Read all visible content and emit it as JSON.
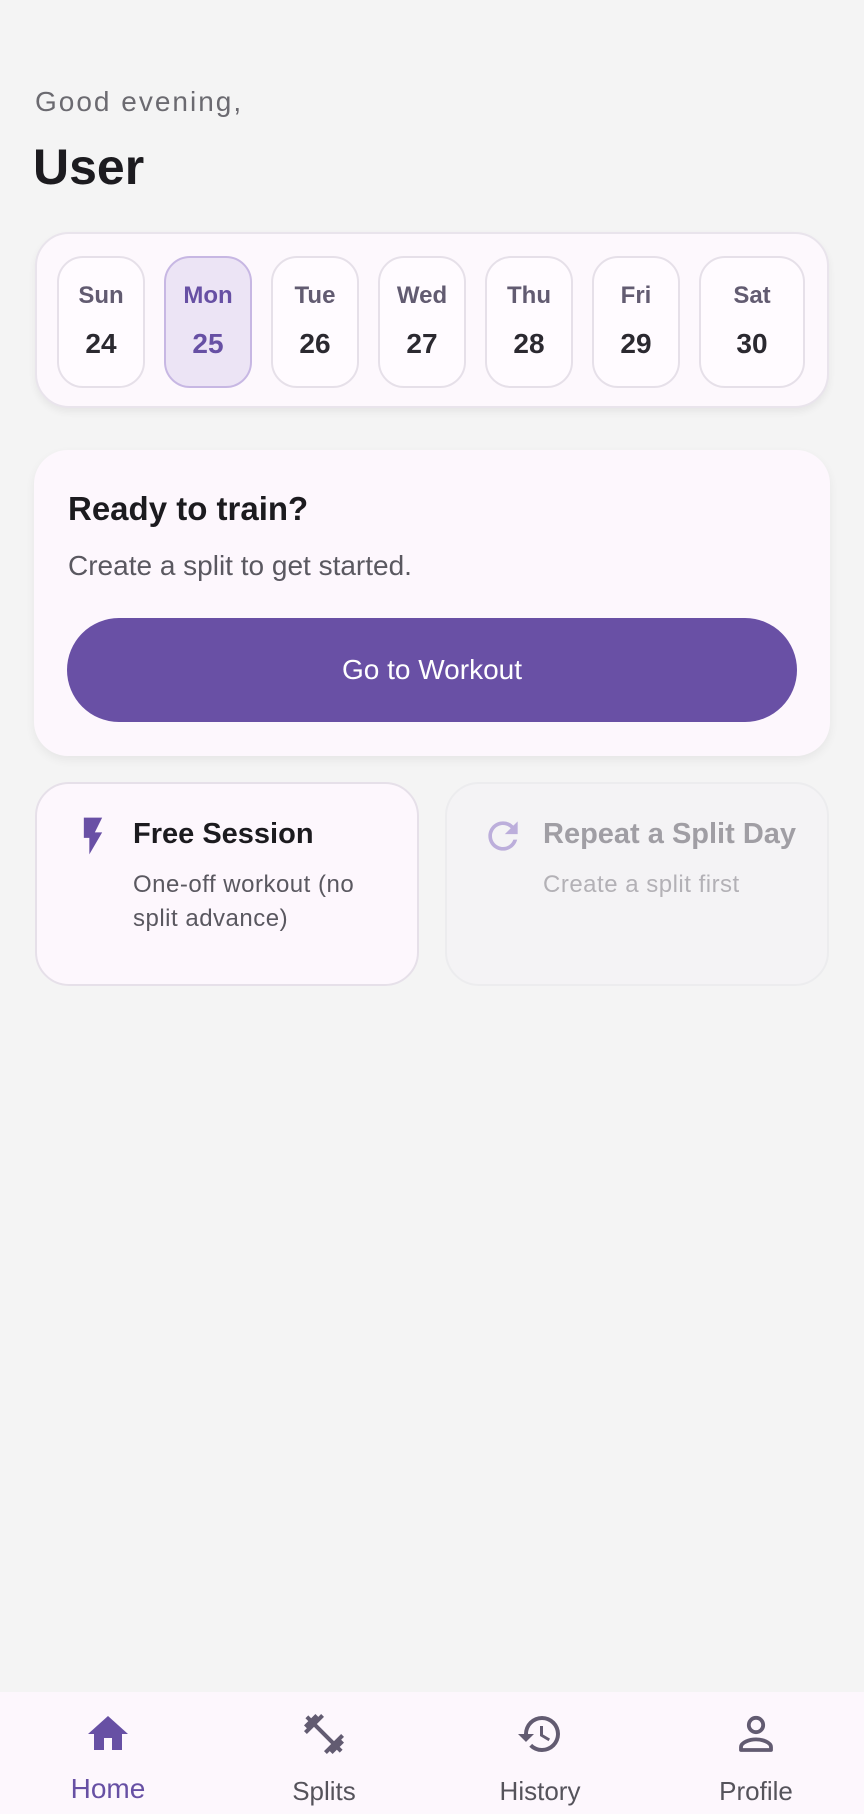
{
  "header": {
    "greeting": "Good evening,",
    "username": "User"
  },
  "week": [
    {
      "day": "Sun",
      "date": "24",
      "selected": false
    },
    {
      "day": "Mon",
      "date": "25",
      "selected": true
    },
    {
      "day": "Tue",
      "date": "26",
      "selected": false
    },
    {
      "day": "Wed",
      "date": "27",
      "selected": false
    },
    {
      "day": "Thu",
      "date": "28",
      "selected": false
    },
    {
      "day": "Fri",
      "date": "29",
      "selected": false
    },
    {
      "day": "Sat",
      "date": "30",
      "selected": false
    }
  ],
  "ready": {
    "title": "Ready to train?",
    "subtitle": "Create a split to get started.",
    "button_label": "Go to Workout"
  },
  "actions": {
    "free_session": {
      "title": "Free Session",
      "subtitle": "One-off workout (no split advance)",
      "icon": "bolt-icon",
      "enabled": true
    },
    "repeat_split": {
      "title": "Repeat a Split Day",
      "subtitle": "Create a split first",
      "icon": "refresh-icon",
      "enabled": false
    }
  },
  "nav": [
    {
      "label": "Home",
      "icon": "home-icon",
      "active": true
    },
    {
      "label": "Splits",
      "icon": "dumbbell-icon",
      "active": false
    },
    {
      "label": "History",
      "icon": "history-icon",
      "active": false
    },
    {
      "label": "Profile",
      "icon": "person-icon",
      "active": false
    }
  ],
  "colors": {
    "primary": "#6950a5",
    "background": "#f4f4f4",
    "surface": "#fdf7fd",
    "selected_day": "#ece4f5",
    "text_dark": "#1c1b1f",
    "text_muted": "#5a5860",
    "nav_inactive": "#55535b",
    "disabled": "#a09ea4"
  }
}
